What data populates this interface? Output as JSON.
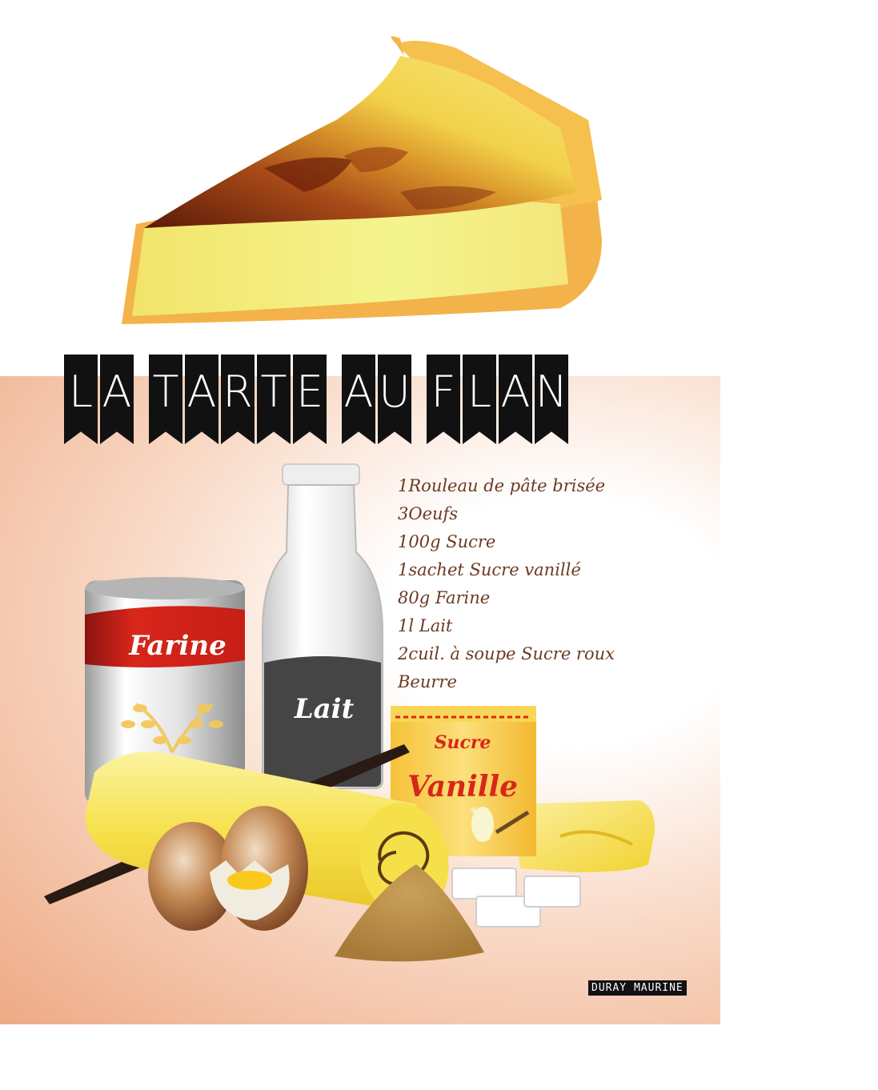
{
  "title": {
    "words": [
      {
        "letters": [
          "L",
          "A"
        ]
      },
      {
        "letters": [
          "T",
          "A",
          "R",
          "T",
          "E"
        ]
      },
      {
        "letters": [
          "A",
          "U"
        ]
      },
      {
        "letters": [
          "F",
          "L",
          "A",
          "N"
        ]
      }
    ]
  },
  "ingredients": [
    "1Rouleau de pâte brisée",
    "3Oeufs",
    "100g Sucre",
    "1sachet Sucre vanillé",
    "80g Farine",
    "1l Lait",
    "2cuil. à soupe Sucre roux",
    "Beurre"
  ],
  "labels": {
    "flour": "Farine",
    "milk": "Lait",
    "sugar_top": "Sucre",
    "sugar_main": "Vanille"
  },
  "signature": "DURAY MAURINE",
  "colors": {
    "ribbon": "#111111",
    "ingredient_text": "#6b3a22",
    "crust": "#f4b64a",
    "custard": "#f3f08a",
    "caramel": "#8a2c10",
    "flour_band": "#d8261b",
    "sugar_box": "#f6c23a",
    "butter": "#f6e04a"
  }
}
